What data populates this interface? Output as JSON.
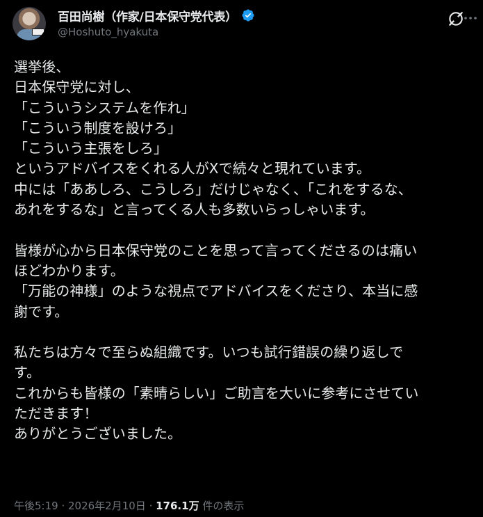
{
  "author": {
    "display_name": "百田尚樹（作家/日本保守党代表）",
    "handle": "@Hoshuto_hyakuta",
    "verified_icon": "verified-badge-icon",
    "avatar_icon": "profile-avatar"
  },
  "header_icons": {
    "grok": "grok-icon",
    "more": "more-icon"
  },
  "tweet": {
    "lines": [
      "選挙後、",
      "日本保守党に対し、",
      "「こういうシステムを作れ」",
      "「こういう制度を設けろ」",
      "「こういう主張をしろ」",
      "というアドバイスをくれる人がXで続々と現れています。",
      "中には「ああしろ、こうしろ」だけじゃなく、「これをするな、",
      "あれをするな」と言ってくる人も多数いらっしゃいます。",
      "",
      "皆様が心から日本保守党のことを思って言ってくださるのは痛い",
      "ほどわかります。",
      "「万能の神様」のような視点でアドバイスをくださり、本当に感",
      "謝です。",
      "",
      "私たちは方々で至らぬ組織です。いつも試行錯誤の繰り返しで",
      "す。",
      "これからも皆様の「素晴らしい」ご助言を大いに参考にさせてい",
      "ただきます！",
      "ありがとうございました。"
    ]
  },
  "meta": {
    "time": "午後5:19",
    "separator1": " · ",
    "date": "2026年2月10日",
    "separator2": " · ",
    "views_count": "176.1万",
    "views_label": " 件の表示"
  },
  "colors": {
    "background": "#000000",
    "text": "#e7e9ea",
    "secondary": "#71767b",
    "verified": "#1d9bf0"
  }
}
